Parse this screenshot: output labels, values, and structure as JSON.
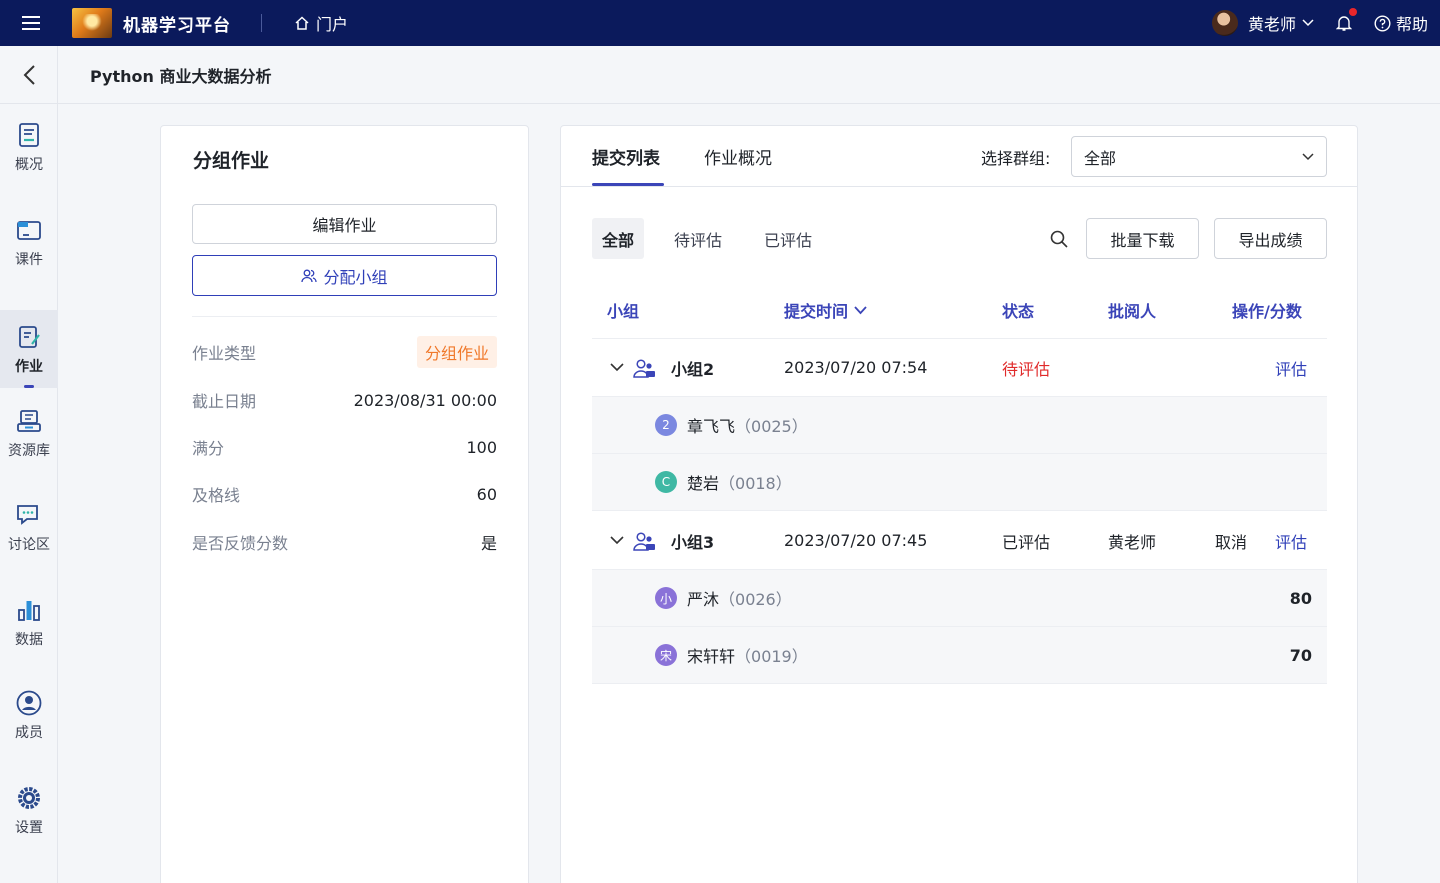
{
  "topbar": {
    "app_title": "机器学习平台",
    "portal_label": "门户",
    "user_name": "黄老师",
    "help_label": "帮助"
  },
  "course": {
    "title": "Python 商业大数据分析"
  },
  "leftnav": {
    "items": [
      {
        "label": "概况",
        "icon": "overview-icon"
      },
      {
        "label": "课件",
        "icon": "courseware-icon"
      },
      {
        "label": "作业",
        "icon": "assignment-icon",
        "active": true
      },
      {
        "label": "资源库",
        "icon": "resource-icon"
      },
      {
        "label": "讨论区",
        "icon": "discussion-icon"
      },
      {
        "label": "数据",
        "icon": "data-icon"
      },
      {
        "label": "成员",
        "icon": "member-icon"
      },
      {
        "label": "设置",
        "icon": "settings-icon"
      }
    ]
  },
  "assignment": {
    "title": "分组作业",
    "edit_label": "编辑作业",
    "assign_label": "分配小组",
    "info": [
      {
        "key": "作业类型",
        "value": "分组作业"
      },
      {
        "key": "截止日期",
        "value": "2023/08/31 00:00"
      },
      {
        "key": "满分",
        "value": "100"
      },
      {
        "key": "及格线",
        "value": "60"
      },
      {
        "key": "是否反馈分数",
        "value": "是"
      }
    ]
  },
  "submissions": {
    "tabs": [
      "提交列表",
      "作业概况"
    ],
    "group_filter_label": "选择群组:",
    "group_filter_value": "全部",
    "filters": [
      "全部",
      "待评估",
      "已评估"
    ],
    "batch_download_label": "批量下载",
    "export_label": "导出成绩",
    "columns": [
      "小组",
      "提交时间",
      "状态",
      "批阅人",
      "操作/分数"
    ],
    "groups": [
      {
        "name": "小组2",
        "time": "2023/07/20 07:54",
        "status": "待评估",
        "reviewer": "",
        "cancel": "",
        "action": "评估",
        "members": [
          {
            "avatar": "2",
            "name": "章飞飞",
            "id": "（0025）",
            "score": ""
          },
          {
            "avatar": "C",
            "name": "楚岩",
            "id": "（0018）",
            "score": ""
          }
        ]
      },
      {
        "name": "小组3",
        "time": "2023/07/20 07:45",
        "status": "已评估",
        "reviewer": "黄老师",
        "cancel": "取消",
        "action": "评估",
        "members": [
          {
            "avatar": "小",
            "name": "严沐",
            "id": "（0026）",
            "score": "80"
          },
          {
            "avatar": "宋",
            "name": "宋轩轩",
            "id": "（0019）",
            "score": "70"
          }
        ]
      }
    ]
  },
  "colors": {
    "topbar": "#0b1a5c",
    "accent": "#3b45b8",
    "pending": "#e02a2a",
    "tag_orange": "#f0782a"
  }
}
